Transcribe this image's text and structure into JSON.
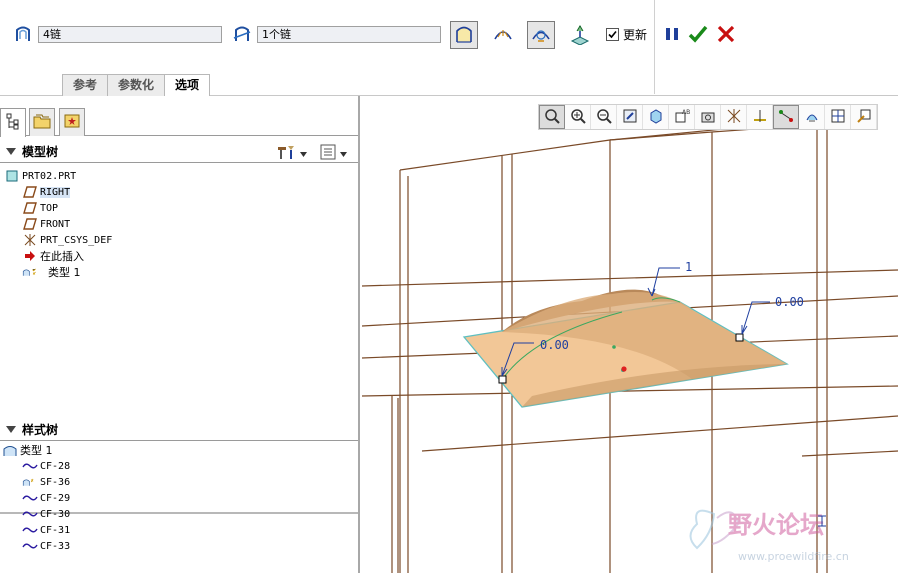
{
  "dashboard": {
    "chain1_value": "4链",
    "chain2_value": "1个链",
    "update_label": "更新",
    "update_checked": true,
    "tabs": [
      {
        "label": "参考",
        "active": false
      },
      {
        "label": "参数化",
        "active": false
      },
      {
        "label": "选项",
        "active": true
      }
    ],
    "icons": {
      "chain1": "surface-chain-icon",
      "chain2": "cross-chain-icon",
      "option1": "boundary-surface-icon",
      "option2": "curvature-icon",
      "option3": "analysis-icon",
      "option4": "projection-icon",
      "pause": "pause-icon",
      "ok": "check-icon",
      "cancel": "close-icon"
    },
    "colors": {
      "ok": "#1a8a1a",
      "cancel": "#c81010",
      "pause": "#1f3f9a"
    }
  },
  "model_tree": {
    "title": "模型树",
    "items": [
      {
        "label": "PRT02.PRT",
        "icon": "part-icon",
        "indent": 0
      },
      {
        "label": "RIGHT",
        "icon": "datum-plane-icon",
        "indent": 1,
        "selected": true
      },
      {
        "label": "TOP",
        "icon": "datum-plane-icon",
        "indent": 1
      },
      {
        "label": "FRONT",
        "icon": "datum-plane-icon",
        "indent": 1
      },
      {
        "label": "PRT_CSYS_DEF",
        "icon": "coordinate-system-icon",
        "indent": 1
      },
      {
        "label": "在此插入",
        "icon": "insert-arrow-icon",
        "indent": 1
      },
      {
        "label": "类型 1",
        "icon": "style-feature-icon",
        "indent": 1
      }
    ]
  },
  "style_tree": {
    "title": "样式树",
    "items": [
      {
        "label": "类型 1",
        "icon": "style-feature-icon",
        "indent": 0
      },
      {
        "label": "CF-28",
        "icon": "curve-icon",
        "indent": 1
      },
      {
        "label": "SF-36",
        "icon": "surface-icon",
        "indent": 1
      },
      {
        "label": "CF-29",
        "icon": "curve-icon",
        "indent": 1
      },
      {
        "label": "CF-30",
        "icon": "curve-icon",
        "indent": 1
      },
      {
        "label": "CF-31",
        "icon": "curve-icon",
        "indent": 1
      },
      {
        "label": "CF-33",
        "icon": "curve-icon",
        "indent": 1
      }
    ]
  },
  "viewport": {
    "annotations": [
      {
        "label": "1"
      },
      {
        "label": "0.00"
      },
      {
        "label": "0.00"
      }
    ],
    "view_toolbar": [
      "zoom-fit-icon",
      "zoom-in-icon",
      "zoom-out-icon",
      "repaint-icon",
      "orient-icon",
      "saved-views-icon",
      "camera-icon",
      "datum-planes-icon",
      "datum-axes-icon",
      "datum-points-icon",
      "csys-icon",
      "layers-icon",
      "spin-center-icon"
    ],
    "watermark": "野火论坛",
    "watermark_url": "www.proewildfire.cn",
    "colors": {
      "surface": "#f2c797",
      "surface_edge": "#5fbfc0",
      "frame": "#7a4a28"
    }
  }
}
